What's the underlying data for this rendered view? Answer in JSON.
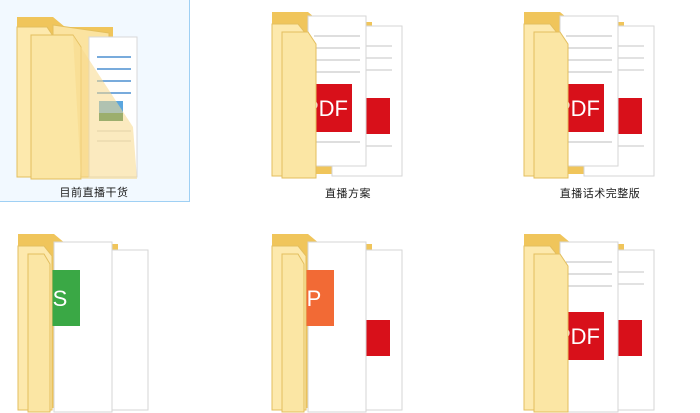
{
  "folders": [
    {
      "name": "目前直播干货",
      "preview": "doc-image",
      "selected": true
    },
    {
      "name": "直播方案",
      "preview": "pdf"
    },
    {
      "name": "直播话术完整版",
      "preview": "pdf"
    },
    {
      "name": "",
      "preview": "xls"
    },
    {
      "name": "",
      "preview": "ppt"
    },
    {
      "name": "",
      "preview": "pdf"
    }
  ],
  "colors": {
    "folder_back": "#f5cf6c",
    "folder_front": "#fde59b",
    "pdf_red": "#d8101a",
    "xls_green": "#3aa845",
    "ppt_orange": "#f26a35",
    "selection_border": "#9fd0f4"
  },
  "badge_text": {
    "pdf": "PDF",
    "xls": "S",
    "ppt": "P"
  }
}
